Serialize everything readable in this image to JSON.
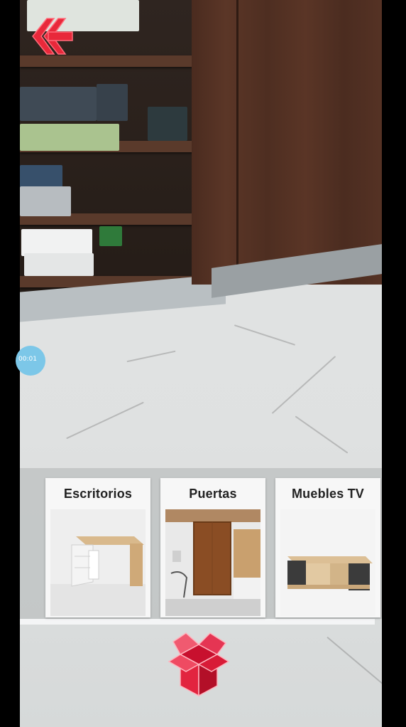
{
  "navigation": {
    "back_icon": "chevron-double-left-icon",
    "back_color": "#e8283a"
  },
  "side_badge": {
    "label": "00:01"
  },
  "catalog": {
    "items": [
      {
        "label": "Escritorios",
        "image": "desk-image"
      },
      {
        "label": "Puertas",
        "image": "door-image"
      },
      {
        "label": "Muebles TV",
        "image": "tv-stand-image"
      }
    ]
  },
  "actions": {
    "open_catalog_icon": "open-box-icon",
    "accent": "#e8283a"
  }
}
